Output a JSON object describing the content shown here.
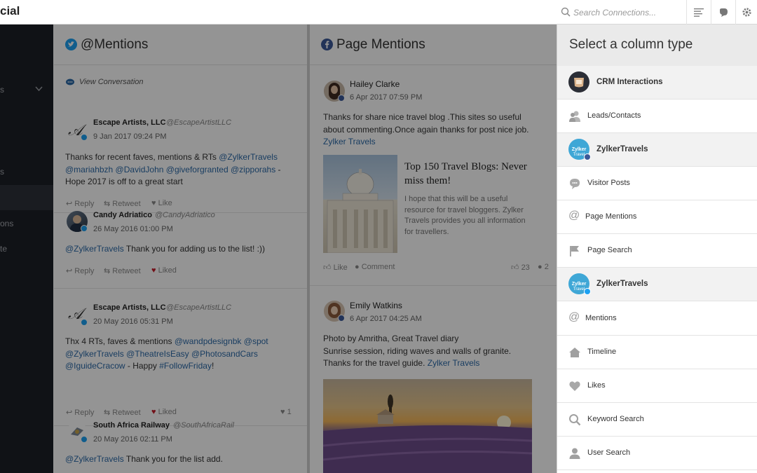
{
  "app": {
    "brand": "cial"
  },
  "search": {
    "placeholder": "Search Connections..."
  },
  "leftnav": {
    "items": [
      {
        "label": "s",
        "has_chevron": true
      },
      {
        "label": "s"
      },
      {
        "label": ""
      },
      {
        "label": "ons"
      },
      {
        "label": "te"
      }
    ]
  },
  "col_mentions": {
    "title": "@Mentions",
    "view_conversation": "View Conversation",
    "posts": [
      {
        "name": "Escape Artists, LLC",
        "handle": "@EscapeArtistLLC",
        "date": "9 Jan 2017 09:24 PM",
        "text_pre": "Thanks for recent faves, mentions & RTs ",
        "text_link1": "@ZylkerTravels",
        "text_link2": "@mariahbzh @DavidJohn @giveforgranted @zipporahs",
        "text_post": " - Hope 2017 is off to a great start",
        "reply": "Reply",
        "retweet": "Retweet",
        "like": "Like"
      },
      {
        "name": "Candy Adriatico",
        "handle": "@CandyAdriatico",
        "date": "26 May 2016 01:00 PM",
        "text_link1": "@ZylkerTravels",
        "text_post": " Thank you for adding us to the list! :))",
        "reply": "Reply",
        "retweet": "Retweet",
        "like": "Liked"
      },
      {
        "name": "Escape Artists, LLC",
        "handle": "@EscapeArtistLLC",
        "date": "20 May 2016 05:31 PM",
        "text_pre": "Thx 4 RTs, faves & mentions ",
        "text_link1": "@wandpdesignbk @spot",
        "text_link2": "@ZylkerTravels @TheatreIsEasy @PhotosandCars",
        "text_link3": "@IguideCracow",
        "text_mid": " - Happy ",
        "text_link4": "#FollowFriday",
        "text_post": "!",
        "reply": "Reply",
        "retweet": "Retweet",
        "like": "Liked",
        "like_count": "1"
      },
      {
        "name": "South Africa Railway",
        "handle": "@SouthAfricaRail",
        "date": "20 May 2016 02:11 PM",
        "text_link1": "@ZylkerTravels",
        "text_post": " Thank you for the list add."
      }
    ]
  },
  "col_page_mentions": {
    "title": "Page Mentions",
    "posts": [
      {
        "name": "Hailey Clarke",
        "date": "6 Apr 2017 07:59 PM",
        "text_line1": "Thanks for share nice travel blog .This sites so useful",
        "text_line2": "about commenting.Once again thanks for post nice job.",
        "link": "Zylker Travels",
        "card_title": "Top 150 Travel Blogs: Never miss them!",
        "card_desc": "I hope that this will be a useful resource for travel bloggers. Zylker Travels provides you all information for travellers.",
        "like": "Like",
        "comment": "Comment",
        "like_count": "23",
        "comment_count": "2"
      },
      {
        "name": "Emily Watkins",
        "date": "6 Apr 2017 04:25 AM",
        "text_line1": "Photo by Amritha, Great Travel diary",
        "text_line2": "Sunrise session, riding waves and walls of granite.",
        "text_line3": "Thanks for the travel guide. ",
        "link": "Zylker Travels"
      }
    ]
  },
  "right_panel": {
    "title": "Select a column type",
    "items": [
      {
        "label": "CRM Interactions",
        "icon": "crm-avatar-icon",
        "bold": true
      },
      {
        "label": "Leads/Contacts",
        "icon": "contacts-icon"
      },
      {
        "label": "ZylkerTravels",
        "icon": "facebook-brand-avatar-icon",
        "bold": true
      },
      {
        "label": "Visitor Posts",
        "icon": "speech-bubble-icon"
      },
      {
        "label": "Page Mentions",
        "icon": "at-icon"
      },
      {
        "label": "Page Search",
        "icon": "flag-icon"
      },
      {
        "label": "ZylkerTravels",
        "icon": "twitter-brand-avatar-icon",
        "bold": true
      },
      {
        "label": "Mentions",
        "icon": "at-icon"
      },
      {
        "label": "Timeline",
        "icon": "home-icon"
      },
      {
        "label": "Likes",
        "icon": "heart-icon"
      },
      {
        "label": "Keyword Search",
        "icon": "search-icon"
      },
      {
        "label": "User Search",
        "icon": "user-icon"
      }
    ]
  },
  "colors": {
    "link": "#2c6aa8",
    "twitter": "#1da1f2",
    "facebook": "#3b5998",
    "liked": "#c41d2a",
    "nav_bg": "#1c1f26"
  }
}
